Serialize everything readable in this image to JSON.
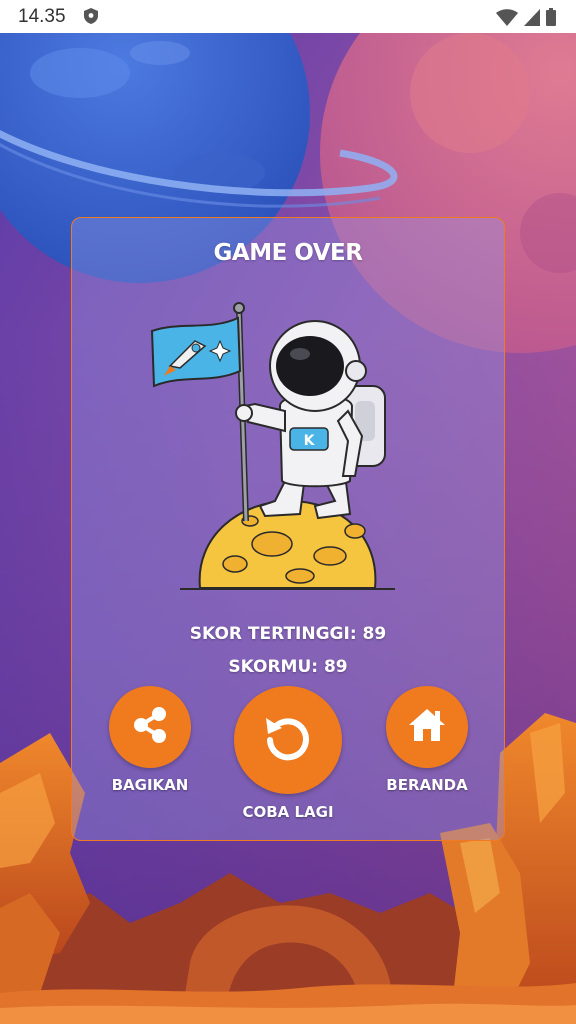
{
  "status_bar": {
    "time": "14.35",
    "icons": [
      "shield-icon",
      "wifi-icon",
      "signal-icon",
      "battery-icon"
    ]
  },
  "game_over": {
    "title": "GAME OVER",
    "high_score_label": "SKOR TERTINGGI: 89",
    "your_score_label": "SKORMU: 89"
  },
  "buttons": {
    "share": {
      "label": "BAGIKAN",
      "icon": "share-icon"
    },
    "retry": {
      "label": "COBA LAGI",
      "icon": "retry-icon"
    },
    "home": {
      "label": "BERANDA",
      "icon": "home-icon"
    }
  },
  "colors": {
    "accent": "#f07a1e",
    "panel_border": "#f07a24",
    "text": "#ffffff"
  }
}
